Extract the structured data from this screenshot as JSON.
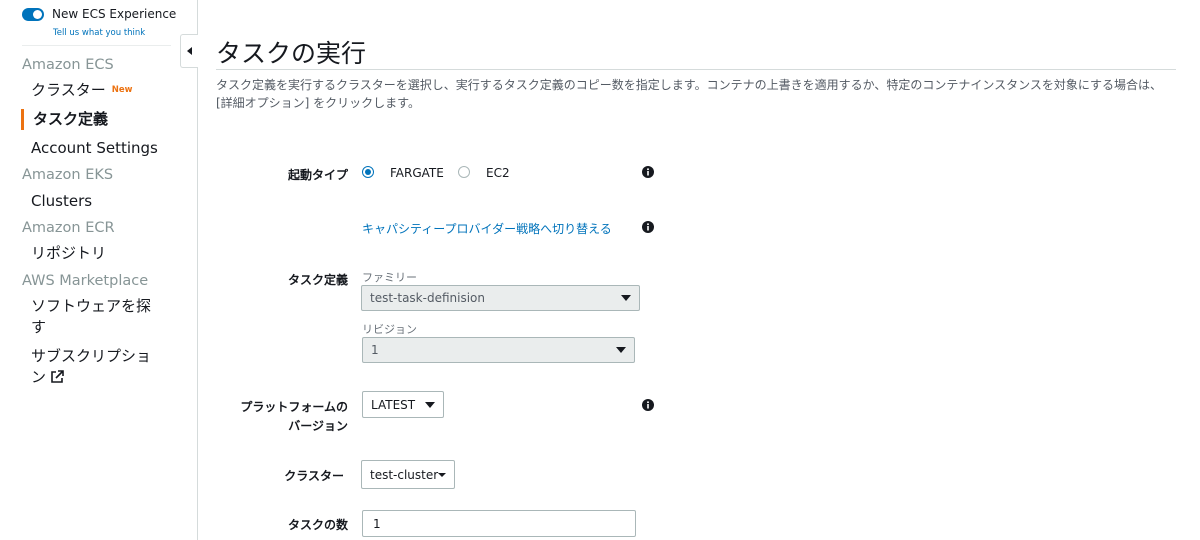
{
  "sidebar": {
    "toggle_label": "New ECS Experience",
    "feedback_link": "Tell us what you think",
    "sections": [
      {
        "title": "Amazon ECS",
        "items": [
          {
            "label": "クラスター",
            "badge": "New"
          },
          {
            "label": "タスク定義",
            "active": true
          },
          {
            "label": "Account Settings"
          }
        ]
      },
      {
        "title": "Amazon EKS",
        "items": [
          {
            "label": "Clusters"
          }
        ]
      },
      {
        "title": "Amazon ECR",
        "items": [
          {
            "label": "リポジトリ"
          }
        ]
      },
      {
        "title": "AWS Marketplace",
        "items": [
          {
            "label_line1": "ソフトウェアを探",
            "label_line2": "す"
          },
          {
            "label_line1": "サブスクリプショ",
            "label_line2": "ン",
            "icon": "external-link-icon"
          }
        ]
      }
    ]
  },
  "page": {
    "title": "タスクの実行",
    "description": "タスク定義を実行するクラスターを選択し、実行するタスク定義のコピー数を指定します。コンテナの上書きを適用するか、特定のコンテナインスタンスを対象にする場合は、[詳細オプション] をクリックします。"
  },
  "form": {
    "launch_type": {
      "label": "起動タイプ",
      "options": [
        "FARGATE",
        "EC2"
      ],
      "selected": "FARGATE"
    },
    "capacity_link": "キャパシティープロバイダー戦略へ切り替える",
    "task_definition": {
      "label": "タスク定義",
      "family_label": "ファミリー",
      "family_value": "test-task-definision",
      "revision_label": "リビジョン",
      "revision_value": "1"
    },
    "platform": {
      "label_line1": "プラットフォームの",
      "label_line2": "バージョン",
      "value": "LATEST"
    },
    "cluster": {
      "label": "クラスター",
      "value": "test-cluster"
    },
    "task_count": {
      "label": "タスクの数",
      "value": "1"
    }
  },
  "colors": {
    "accent": "#0073bb",
    "active_marker": "#ec7211",
    "badge": "#ec7211"
  }
}
